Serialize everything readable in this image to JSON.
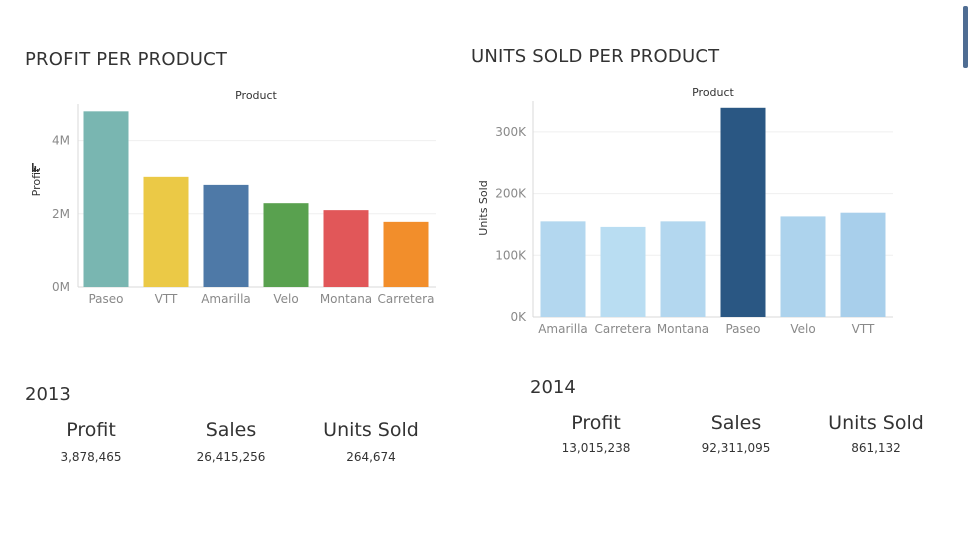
{
  "colors": {
    "scrollbar": "#4f6d93",
    "grid": "#efefef",
    "axis": "#d9d9d9",
    "tick_text": "#898989",
    "label_text": "#333333"
  },
  "chart_data": [
    {
      "type": "bar",
      "title": "PROFIT PER PRODUCT",
      "header": "Product",
      "ylabel": "Profit",
      "categories": [
        "Paseo",
        "VTT",
        "Amarilla",
        "Velo",
        "Montana",
        "Carretera"
      ],
      "values": [
        4800000,
        3010000,
        2790000,
        2290000,
        2100000,
        1780000
      ],
      "yticks": [
        0,
        2000000,
        4000000
      ],
      "ytick_labels": [
        "0M",
        "2M",
        "4M"
      ],
      "ylim": [
        0,
        5000000
      ],
      "colors": [
        "#79b6b1",
        "#ebc946",
        "#4e79a7",
        "#59a14f",
        "#e15759",
        "#f28e2b"
      ],
      "grid": true
    },
    {
      "type": "bar",
      "title": "UNITS SOLD PER PRODUCT",
      "header": "Product",
      "ylabel": "Units Sold",
      "categories": [
        "Amarilla",
        "Carretera",
        "Montana",
        "Paseo",
        "Velo",
        "VTT"
      ],
      "values": [
        155000,
        146000,
        155000,
        339000,
        163000,
        169000
      ],
      "yticks": [
        0,
        100000,
        200000,
        300000
      ],
      "ytick_labels": [
        "0K",
        "100K",
        "200K",
        "300K"
      ],
      "ylim": [
        0,
        350000
      ],
      "colors": [
        "#b3d7ef",
        "#b9ddf2",
        "#b3d7ef",
        "#2a5783",
        "#add3ed",
        "#a8cfeb"
      ],
      "grid": true
    }
  ],
  "summary_2013": {
    "year": "2013",
    "profit_label": "Profit",
    "profit_value": "3,878,465",
    "sales_label": "Sales",
    "sales_value": "26,415,256",
    "units_label": "Units Sold",
    "units_value": "264,674"
  },
  "summary_2014": {
    "year": "2014",
    "profit_label": "Profit",
    "profit_value": "13,015,238",
    "sales_label": "Sales",
    "sales_value": "92,311,095",
    "units_label": "Units Sold",
    "units_value": "861,132"
  }
}
